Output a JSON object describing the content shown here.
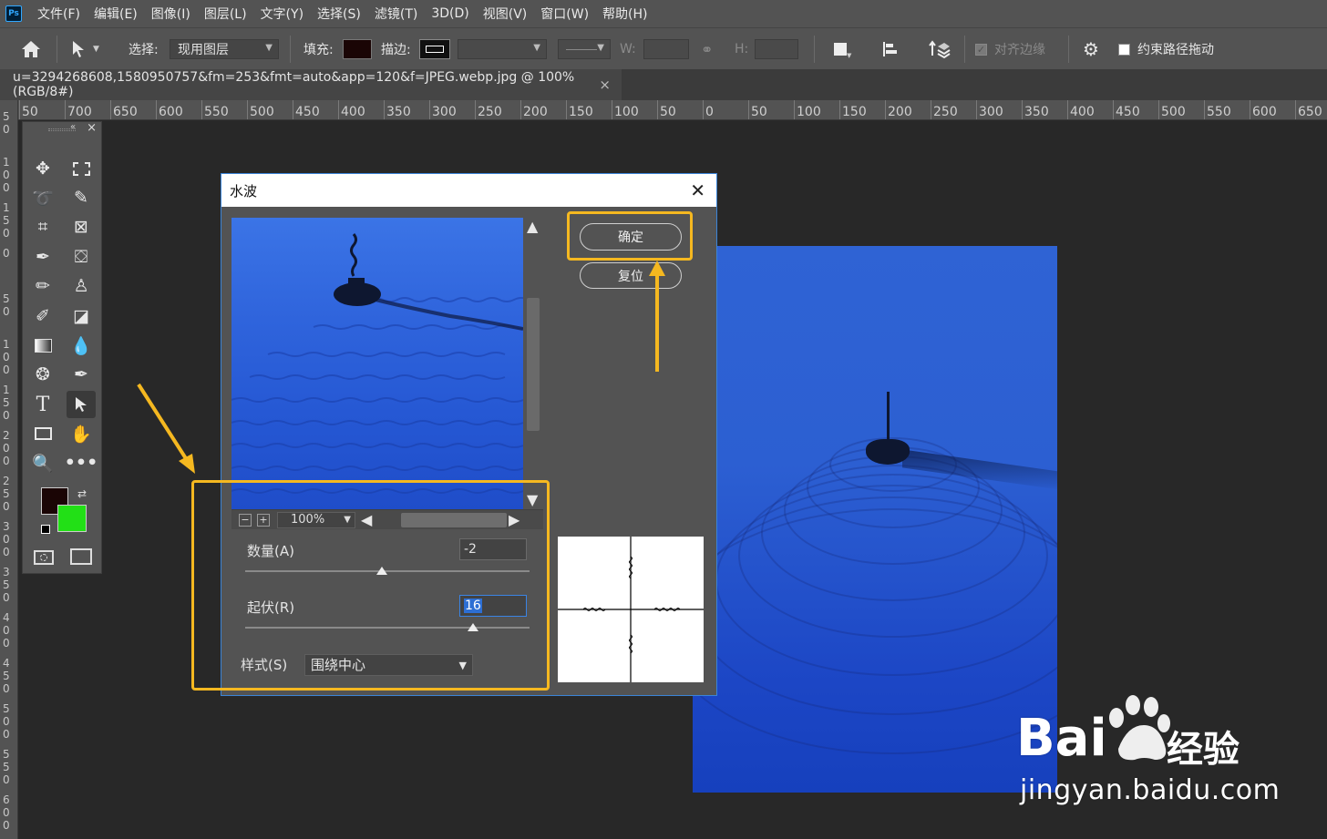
{
  "app": {
    "logo": "Ps"
  },
  "menu": [
    "文件(F)",
    "编辑(E)",
    "图像(I)",
    "图层(L)",
    "文字(Y)",
    "选择(S)",
    "滤镜(T)",
    "3D(D)",
    "视图(V)",
    "窗口(W)",
    "帮助(H)"
  ],
  "options": {
    "select_label": "选择:",
    "select_value": "现用图层",
    "fill_label": "填充:",
    "stroke_label": "描边:",
    "w_label": "W:",
    "h_label": "H:",
    "align_edges": "对齐边缘",
    "constrain_path": "约束路径拖动"
  },
  "document": {
    "tab_title": "u=3294268608,1580950757&fm=253&fmt=auto&app=120&f=JPEG.webp.jpg @ 100%(RGB/8#)",
    "close": "×"
  },
  "ruler": {
    "marks": [
      "50",
      "700",
      "650",
      "600",
      "550",
      "500",
      "450",
      "400",
      "350",
      "300",
      "250",
      "200",
      "150",
      "100",
      "50",
      "0",
      "50",
      "100",
      "150",
      "200",
      "250",
      "300",
      "350",
      "400",
      "450",
      "500",
      "550",
      "600",
      "650"
    ]
  },
  "colors": {
    "foreground": "#1a0505",
    "background": "#22e016",
    "highlight": "#f5b820",
    "water": "#2c5fd2"
  },
  "dialog": {
    "title": "水波",
    "ok": "确定",
    "reset": "复位",
    "zoom": "100%",
    "amount_label": "数量(A)",
    "amount_value": "-2",
    "amount_level": 0.48,
    "ridges_label": "起伏(R)",
    "ridges_value": "16",
    "ridges_level": 0.8,
    "style_label": "样式(S)",
    "style_value": "围绕中心"
  },
  "watermark": {
    "brand": "Bai",
    "brand_suffix": "经验",
    "url": "jingyan.baidu.com"
  }
}
